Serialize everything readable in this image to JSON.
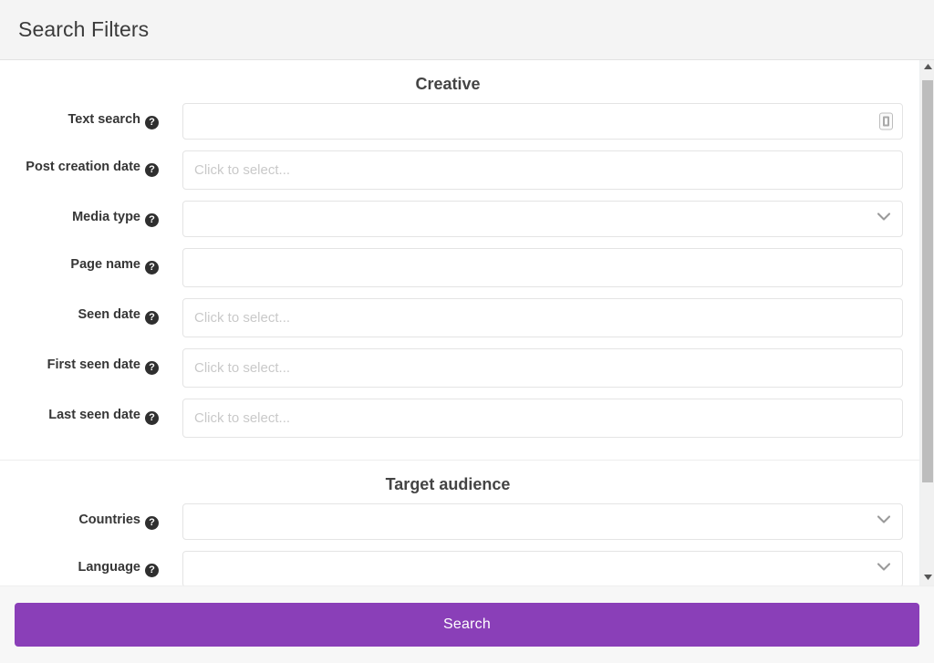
{
  "header": {
    "title": "Search Filters"
  },
  "colors": {
    "accent_purple": "#8a3fb8",
    "header_bg": "#f4f4f4",
    "footer_bg": "#f7f7f7",
    "label_text": "#363636",
    "placeholder": "#c9c9c9",
    "field_border": "#e4e4e4",
    "scroll_thumb": "#bdbdbd"
  },
  "sections": [
    {
      "title": "Creative",
      "rows": [
        {
          "label": "Text search",
          "help": "?",
          "type": "text",
          "value": "",
          "placeholder": "",
          "trailing_icon": "dictionary-icon"
        },
        {
          "label": "Post creation date",
          "help": "?",
          "type": "text",
          "value": "",
          "placeholder": "Click to select...",
          "label_wraps": true
        },
        {
          "label": "Media type",
          "help": "?",
          "type": "select",
          "value": "",
          "placeholder": ""
        },
        {
          "label": "Page name",
          "help": "?",
          "type": "text",
          "value": "",
          "placeholder": ""
        },
        {
          "label": "Seen date",
          "help": "?",
          "type": "text",
          "value": "",
          "placeholder": "Click to select..."
        },
        {
          "label": "First seen date",
          "help": "?",
          "type": "text",
          "value": "",
          "placeholder": "Click to select..."
        },
        {
          "label": "Last seen date",
          "help": "?",
          "type": "text",
          "value": "",
          "placeholder": "Click to select..."
        }
      ]
    },
    {
      "title": "Target audience",
      "rows": [
        {
          "label": "Countries",
          "help": "?",
          "type": "select",
          "value": "",
          "placeholder": ""
        },
        {
          "label": "Language",
          "help": "?",
          "type": "select",
          "value": "",
          "placeholder": ""
        }
      ]
    }
  ],
  "scrollbar": {
    "up_arrow": "chevron-up-icon",
    "down_arrow": "chevron-down-icon"
  },
  "footer": {
    "search_label": "Search"
  }
}
